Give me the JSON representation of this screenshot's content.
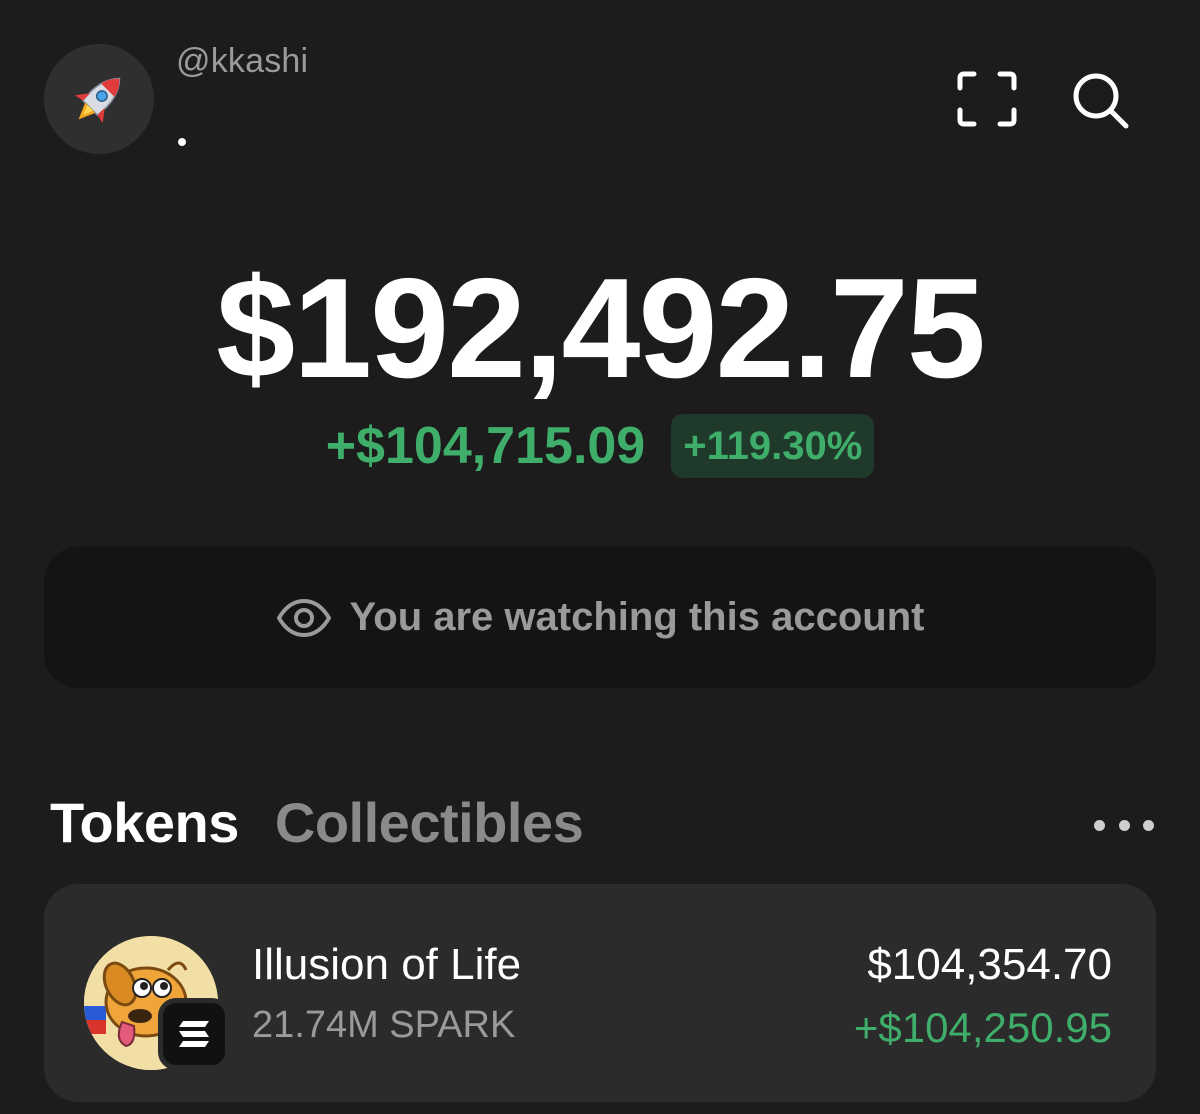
{
  "header": {
    "username": "@kkashi",
    "avatar_icon": "rocket-icon",
    "scan_icon": "scan-icon",
    "search_icon": "search-icon"
  },
  "balance": {
    "total": "$192,492.75",
    "change_amount": "+$104,715.09",
    "change_percent": "+119.30%"
  },
  "watch_banner": {
    "icon": "eye-icon",
    "text": "You are watching this account"
  },
  "tabs": {
    "items": [
      {
        "label": "Tokens",
        "active": true
      },
      {
        "label": "Collectibles",
        "active": false
      }
    ],
    "more_icon": "more-horizontal-icon"
  },
  "tokens": [
    {
      "name": "Illusion of Life",
      "amount": "21.74M SPARK",
      "value": "$104,354.70",
      "change": "+$104,250.95",
      "chain_icon": "solana-icon"
    }
  ],
  "colors": {
    "background": "#1c1c1c",
    "positive": "#3fae6a",
    "positive_bg": "#1f3a2a",
    "muted_text": "#9a9a9a"
  }
}
